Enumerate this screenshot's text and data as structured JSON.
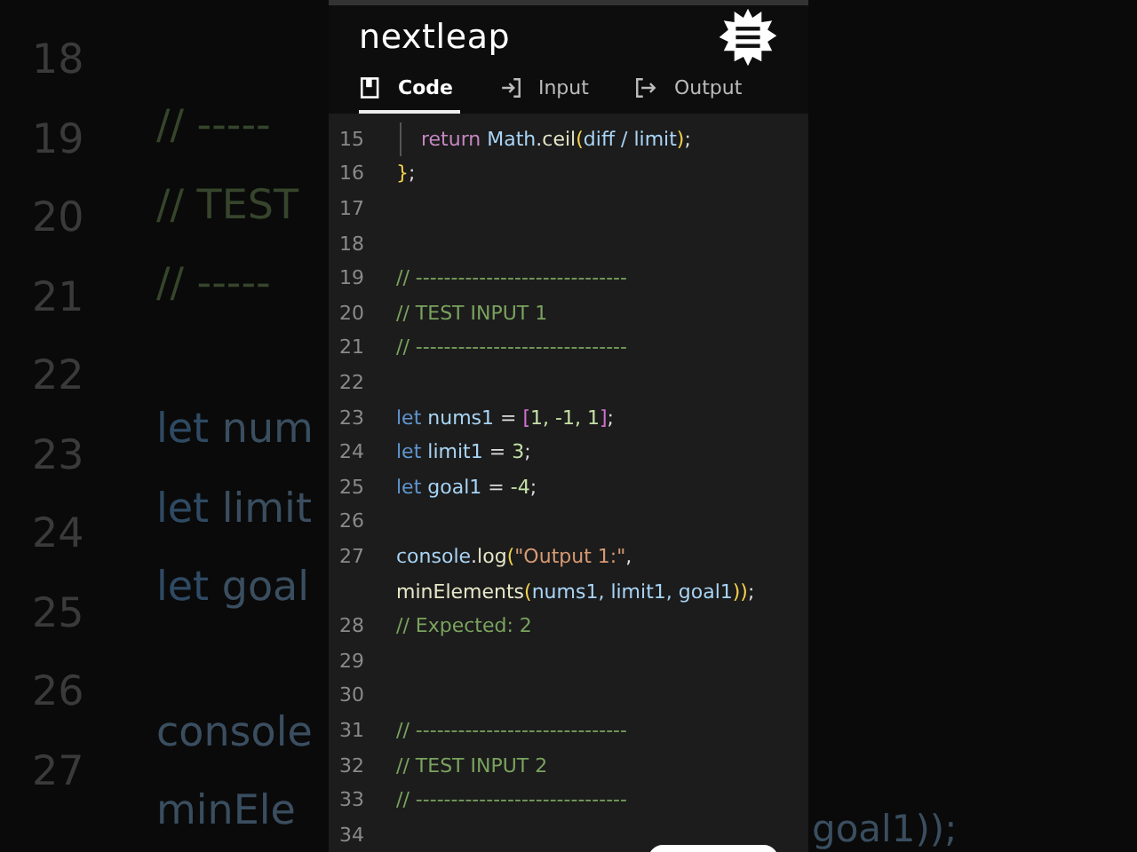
{
  "background_left": {
    "line_numbers": [
      "18",
      "19",
      "20",
      "21",
      "22",
      "23",
      "24",
      "25",
      "26",
      "27"
    ],
    "lines": [
      {
        "kind": "blank"
      },
      {
        "kind": "comment",
        "text": "// -----"
      },
      {
        "kind": "comment",
        "text": "// TEST"
      },
      {
        "kind": "comment",
        "text": "// -----"
      },
      {
        "kind": "blank"
      },
      {
        "kind": "decl",
        "keyword": "let",
        "text": "num"
      },
      {
        "kind": "decl",
        "keyword": "let",
        "text": "limit"
      },
      {
        "kind": "decl",
        "keyword": "let",
        "text": "goal"
      },
      {
        "kind": "blank"
      },
      {
        "kind": "ident",
        "text": "console"
      },
      {
        "kind": "ident",
        "text": "minEle"
      }
    ]
  },
  "background_right": {
    "text": "goal1));"
  },
  "app": {
    "logo": "nextleap",
    "tabs": [
      {
        "label": "Code",
        "selected": true
      },
      {
        "label": "Input",
        "selected": false
      },
      {
        "label": "Output",
        "selected": false
      }
    ],
    "code": [
      {
        "number": "15",
        "indent": true,
        "tokens": [
          {
            "kind": "keyword",
            "text": "return "
          },
          {
            "kind": "ident",
            "text": "Math"
          },
          {
            "kind": "plain",
            "text": "."
          },
          {
            "kind": "func",
            "text": "ceil"
          },
          {
            "kind": "bracket",
            "text": "("
          },
          {
            "kind": "ident",
            "text": "diff / limit"
          },
          {
            "kind": "bracket",
            "text": ")"
          },
          {
            "kind": "plain",
            "text": ";"
          }
        ]
      },
      {
        "number": "16",
        "indent": false,
        "tokens": [
          {
            "kind": "bracket",
            "text": "}"
          },
          {
            "kind": "plain",
            "text": ";"
          }
        ]
      },
      {
        "number": "17"
      },
      {
        "number": "18"
      },
      {
        "number": "19",
        "indent": false,
        "tokens": [
          {
            "kind": "comment",
            "text": "// ------------------------------"
          }
        ]
      },
      {
        "number": "20",
        "indent": false,
        "tokens": [
          {
            "kind": "comment",
            "text": "// TEST INPUT 1"
          }
        ]
      },
      {
        "number": "21",
        "indent": false,
        "tokens": [
          {
            "kind": "comment",
            "text": "// ------------------------------"
          }
        ]
      },
      {
        "number": "22"
      },
      {
        "number": "23",
        "indent": false,
        "tokens": [
          {
            "kind": "decl",
            "text": "let "
          },
          {
            "kind": "ident",
            "text": "nums1"
          },
          {
            "kind": "plain",
            "text": " = "
          },
          {
            "kind": "square",
            "text": "["
          },
          {
            "kind": "number",
            "text": "1, -1, 1"
          },
          {
            "kind": "square",
            "text": "]"
          },
          {
            "kind": "plain",
            "text": ";"
          }
        ]
      },
      {
        "number": "24",
        "indent": false,
        "tokens": [
          {
            "kind": "decl",
            "text": "let "
          },
          {
            "kind": "ident",
            "text": "limit1"
          },
          {
            "kind": "plain",
            "text": " = "
          },
          {
            "kind": "number",
            "text": "3"
          },
          {
            "kind": "plain",
            "text": ";"
          }
        ]
      },
      {
        "number": "25",
        "indent": false,
        "tokens": [
          {
            "kind": "decl",
            "text": "let "
          },
          {
            "kind": "ident",
            "text": "goal1"
          },
          {
            "kind": "plain",
            "text": " = "
          },
          {
            "kind": "number",
            "text": "-4"
          },
          {
            "kind": "plain",
            "text": ";"
          }
        ]
      },
      {
        "number": "26"
      },
      {
        "number": "27",
        "indent": false,
        "tokens": [
          {
            "kind": "ident",
            "text": "console"
          },
          {
            "kind": "plain",
            "text": "."
          },
          {
            "kind": "func",
            "text": "log"
          },
          {
            "kind": "bracket",
            "text": "("
          },
          {
            "kind": "string",
            "text": "\"Output 1:\""
          },
          {
            "kind": "plain",
            "text": ","
          }
        ]
      },
      {
        "indent": false,
        "tokens": [
          {
            "kind": "func",
            "text": "minElements"
          },
          {
            "kind": "bracket",
            "text": "("
          },
          {
            "kind": "ident",
            "text": "nums1, limit1, goal1"
          },
          {
            "kind": "bracket",
            "text": "))"
          },
          {
            "kind": "plain",
            "text": ";"
          }
        ]
      },
      {
        "number": "28",
        "indent": false,
        "tokens": [
          {
            "kind": "comment",
            "text": "// Expected: 2"
          }
        ]
      },
      {
        "number": "29"
      },
      {
        "number": "30"
      },
      {
        "number": "31",
        "indent": false,
        "tokens": [
          {
            "kind": "comment",
            "text": "// ------------------------------"
          }
        ]
      },
      {
        "number": "32",
        "indent": false,
        "tokens": [
          {
            "kind": "comment",
            "text": "// TEST INPUT 2"
          }
        ]
      },
      {
        "number": "33",
        "indent": false,
        "tokens": [
          {
            "kind": "comment",
            "text": "// ------------------------------"
          }
        ]
      },
      {
        "number": "34"
      }
    ]
  }
}
